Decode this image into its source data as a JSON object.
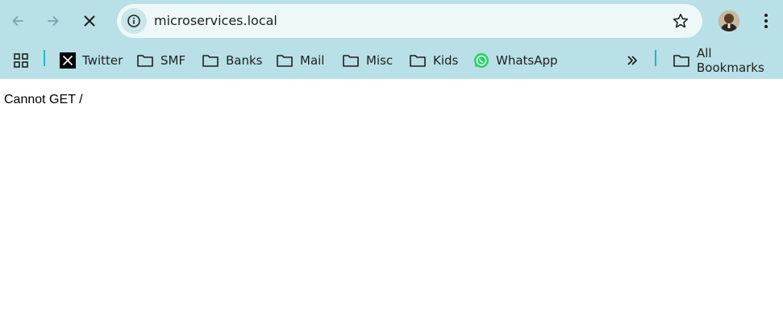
{
  "browser": {
    "url": "microservices.local",
    "colors": {
      "toolbar": "#b8e0e6",
      "omnibox": "#eef8f9",
      "separator": "#29b3c2"
    }
  },
  "toolbar": {
    "back_icon": "arrow-left-icon",
    "forward_icon": "arrow-right-icon",
    "stop_icon": "close-icon",
    "site_info_icon": "info-icon",
    "bookmark_star_icon": "star-icon",
    "menu_icon": "more-vert-icon"
  },
  "bookmarks": {
    "items": [
      {
        "label": "Twitter",
        "icon": "x-logo-icon"
      },
      {
        "label": "SMF",
        "icon": "folder-icon"
      },
      {
        "label": "Banks",
        "icon": "folder-icon"
      },
      {
        "label": "Mail",
        "icon": "folder-icon"
      },
      {
        "label": "Misc",
        "icon": "folder-icon"
      },
      {
        "label": "Kids",
        "icon": "folder-icon"
      },
      {
        "label": "WhatsApp",
        "icon": "whatsapp-icon"
      }
    ],
    "all_bookmarks": "All Bookmarks"
  },
  "page": {
    "message": "Cannot GET /"
  }
}
